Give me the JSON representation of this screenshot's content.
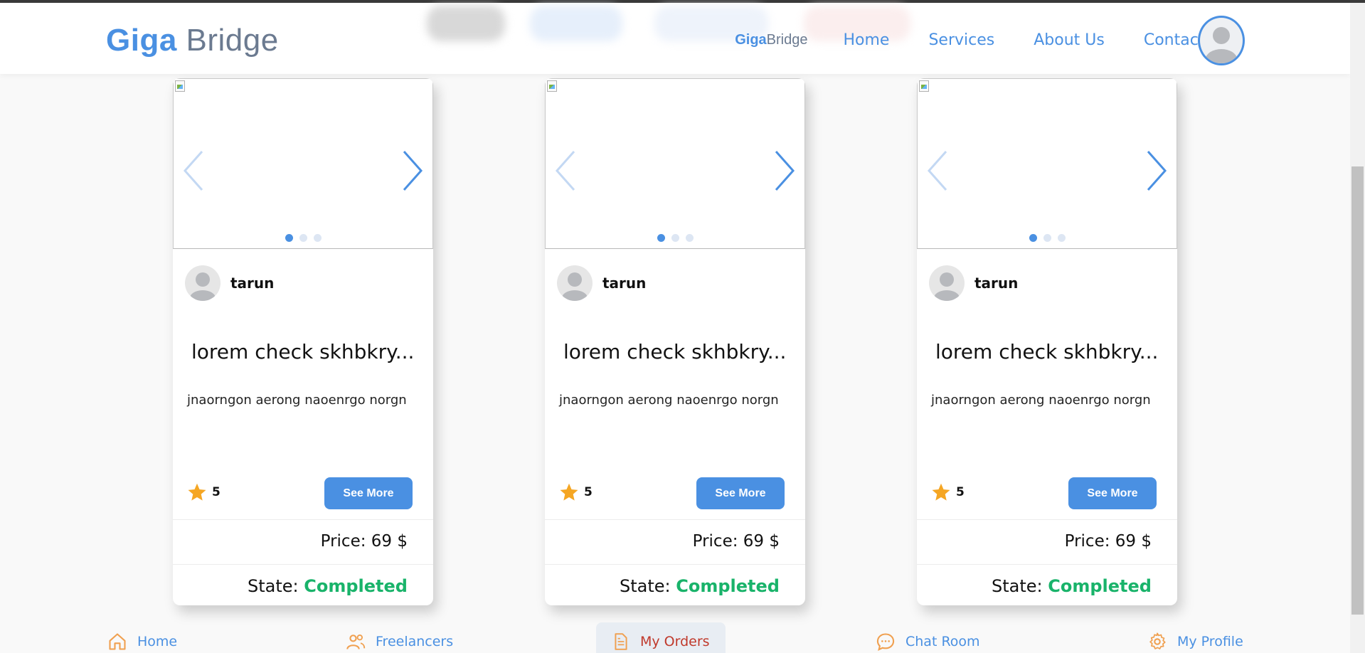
{
  "header": {
    "logo_giga": "Giga",
    "logo_bridge": "Bridge",
    "mini_logo_giga": "Giga",
    "mini_logo_bridge": "Bridge",
    "nav": [
      "Home",
      "Services",
      "About Us",
      "Contact Us"
    ]
  },
  "cards": [
    {
      "author": "tarun",
      "title": "lorem check skhbkry...",
      "description": "jnaorngon aerong naoenrgo norgn",
      "rating": "5",
      "button": "See More",
      "price": "Price: 69 $",
      "state_label": "State:",
      "state_value": "Completed",
      "carousel_slides": 3,
      "active_slide": 1
    },
    {
      "author": "tarun",
      "title": "lorem check skhbkry...",
      "description": "jnaorngon aerong naoenrgo norgn",
      "rating": "5",
      "button": "See More",
      "price": "Price: 69 $",
      "state_label": "State:",
      "state_value": "Completed",
      "carousel_slides": 3,
      "active_slide": 1
    },
    {
      "author": "tarun",
      "title": "lorem check skhbkry...",
      "description": "jnaorngon aerong naoenrgo norgn",
      "rating": "5",
      "button": "See More",
      "price": "Price: 69 $",
      "state_label": "State:",
      "state_value": "Completed",
      "carousel_slides": 3,
      "active_slide": 1
    }
  ],
  "bottom_nav": {
    "items": [
      "Home",
      "Freelancers",
      "My Orders",
      "Chat Room",
      "My Profile"
    ],
    "active": "My Orders"
  },
  "colors": {
    "accent": "#4a90e2",
    "completed": "#19b36a",
    "active_nav": "#c0392b",
    "star": "#f5a623",
    "nav_icon": "#f0a050"
  }
}
